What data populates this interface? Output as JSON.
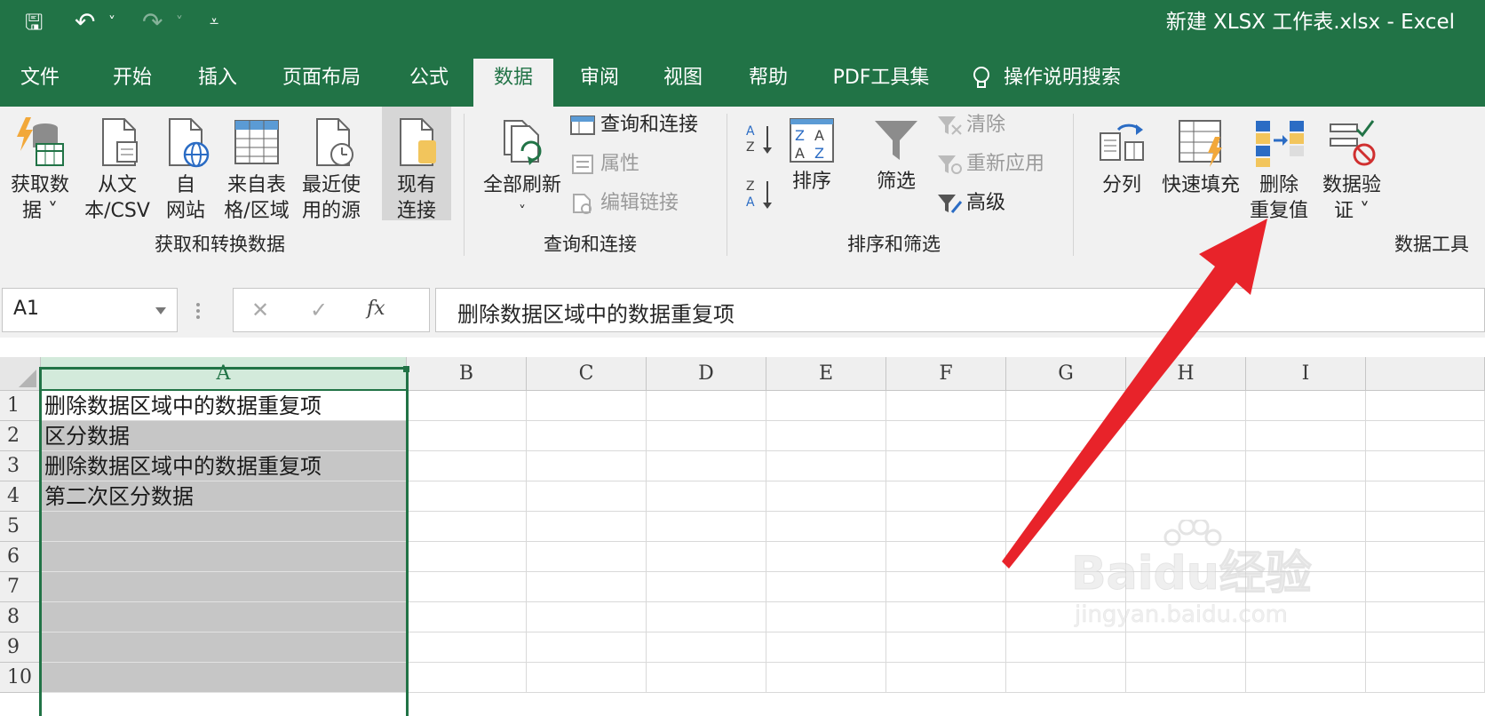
{
  "titlebar": {
    "document_title": "新建 XLSX 工作表.xlsx  -  Excel",
    "save_glyph": "🖫",
    "undo_glyph": "↶",
    "redo_glyph": "↷",
    "dropdown_glyph": "˅",
    "customize_glyph": "⩡"
  },
  "tabs": [
    "文件",
    "开始",
    "插入",
    "页面布局",
    "公式",
    "数据",
    "审阅",
    "视图",
    "帮助",
    "PDF工具集"
  ],
  "active_tab": "数据",
  "tell_me": {
    "label": "操作说明搜索"
  },
  "ribbon": {
    "get_transform": {
      "group_label": "获取和转换数据",
      "get_data": [
        "获取数",
        "据 ˅"
      ],
      "from_text": [
        "从文",
        "本/CSV"
      ],
      "from_web": [
        "自",
        "网站"
      ],
      "from_table": [
        "来自表",
        "格/区域"
      ],
      "recent_sources": [
        "最近使",
        "用的源"
      ],
      "existing_connections": [
        "现有",
        "连接"
      ]
    },
    "queries": {
      "group_label": "查询和连接",
      "refresh_all": [
        "全部刷新",
        "˅"
      ],
      "queries_connections": "查询和连接",
      "properties": "属性",
      "edit_links": "编辑链接"
    },
    "sort_filter": {
      "group_label": "排序和筛选",
      "sort": "排序",
      "filter": "筛选",
      "clear": "清除",
      "reapply": "重新应用",
      "advanced": "高级"
    },
    "data_tools": {
      "group_label": "数据工具",
      "text_to_columns": "分列",
      "flash_fill": "快速填充",
      "remove_duplicates": [
        "删除",
        "重复值"
      ],
      "data_validation": [
        "数据验",
        "证 ˅"
      ]
    }
  },
  "formula_bar": {
    "name_box": "A1",
    "cancel_glyph": "✕",
    "enter_glyph": "✓",
    "fx_glyph": "fx",
    "formula": "删除数据区域中的数据重复项"
  },
  "sheet": {
    "columns": [
      "A",
      "B",
      "C",
      "D",
      "E",
      "F",
      "G",
      "H",
      "I"
    ],
    "rows": [
      "1",
      "2",
      "3",
      "4",
      "5",
      "6",
      "7",
      "8",
      "9",
      "10"
    ],
    "column_a_values": [
      "删除数据区域中的数据重复项",
      "区分数据",
      "删除数据区域中的数据重复项",
      "第二次区分数据",
      "",
      "",
      "",
      "",
      "",
      ""
    ],
    "selected_range": "A1:A10"
  },
  "watermark": {
    "logo": "Baidu经验",
    "url": "jingyan.baidu.com"
  },
  "colors": {
    "excel_green": "#217346",
    "ribbon_bg": "#f1f1f1",
    "selection_fill": "#c6c6c6",
    "arrow_red": "#e8232a"
  }
}
